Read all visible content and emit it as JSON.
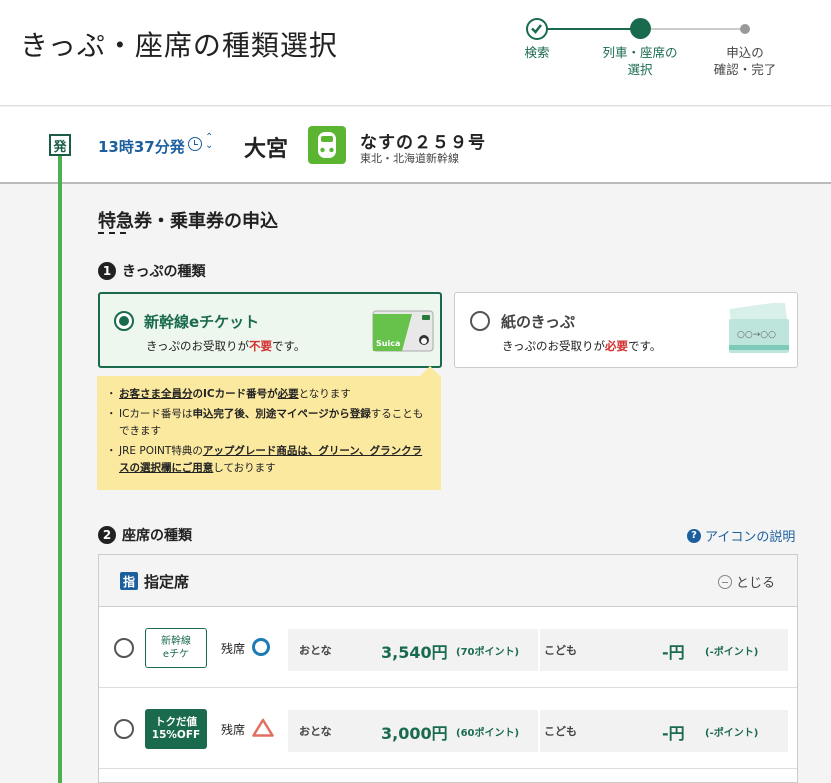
{
  "page": {
    "title": "きっぷ・座席の種類選択"
  },
  "steps": [
    {
      "label_lines": [
        "検索"
      ],
      "state": "done"
    },
    {
      "label_lines": [
        "列車・座席の",
        "選択"
      ],
      "state": "current"
    },
    {
      "label_lines": [
        "申込の",
        "確認・完了"
      ],
      "state": "todo"
    }
  ],
  "train": {
    "dep_badge": "発",
    "departure_time": "13時37分発",
    "station": "大宮",
    "name": "なすの２５９号",
    "line": "東北・北海道新幹線"
  },
  "section": {
    "title": "特急券・乗車券の申込"
  },
  "ticket_type": {
    "number": "1",
    "heading": "きっぷの種類",
    "options": [
      {
        "title": "新幹線eチケット",
        "sub_before": "きっぷのお受取りが",
        "sub_em": "不要",
        "sub_after": "です。",
        "selected": true,
        "card_image": "suica-card-image"
      },
      {
        "title": "紙のきっぷ",
        "sub_before": "きっぷのお受取りが",
        "sub_em": "必要",
        "sub_after": "です。",
        "selected": false,
        "card_image": "paper-ticket-image"
      }
    ],
    "notes": [
      {
        "parts": [
          [
            "お客さま全員分",
            "u"
          ],
          [
            "のICカード番号が",
            "b"
          ],
          [
            "必要",
            "b"
          ],
          [
            "となります",
            ""
          ]
        ]
      },
      {
        "parts": [
          [
            "ICカード番号は",
            ""
          ],
          [
            "申込完了後、別途マイページから登録",
            "b"
          ],
          [
            "することもできます",
            ""
          ]
        ]
      },
      {
        "parts": [
          [
            "JRE POINT特典の",
            ""
          ],
          [
            "アップグレード商品は、グリーン、グランクラスの選択欄にご用意",
            "bu"
          ],
          [
            "しております",
            ""
          ]
        ]
      }
    ]
  },
  "seat_type": {
    "number": "2",
    "heading": "座席の種類",
    "help_icon": "?",
    "help_label": "アイコンの説明",
    "panel": {
      "icon": "指",
      "label": "指定席",
      "close_label": "とじる",
      "rows": [
        {
          "tag_lines": [
            "新幹線",
            "eチケ"
          ],
          "tag_style": "outline",
          "avail_label": "残席",
          "avail_mark": "circle",
          "adult_label": "おとな",
          "adult_price": "3,540円",
          "adult_points": "(70ポイント)",
          "child_label": "こども",
          "child_price": "-円",
          "child_points": "(-ポイント)"
        },
        {
          "tag_lines": [
            "トクだ値",
            "15%OFF"
          ],
          "tag_style": "solid",
          "avail_label": "残席",
          "avail_mark": "triangle",
          "adult_label": "おとな",
          "adult_price": "3,000円",
          "adult_points": "(60ポイント)",
          "child_label": "こども",
          "child_price": "-円",
          "child_points": "(-ポイント)"
        }
      ]
    }
  },
  "colors": {
    "brand_green": "#1a6b4e",
    "rail_green": "#4caf50",
    "link_blue": "#1c5f9e",
    "note_yellow": "#fbe9a0",
    "emphasis_red": "#d32f2f"
  }
}
